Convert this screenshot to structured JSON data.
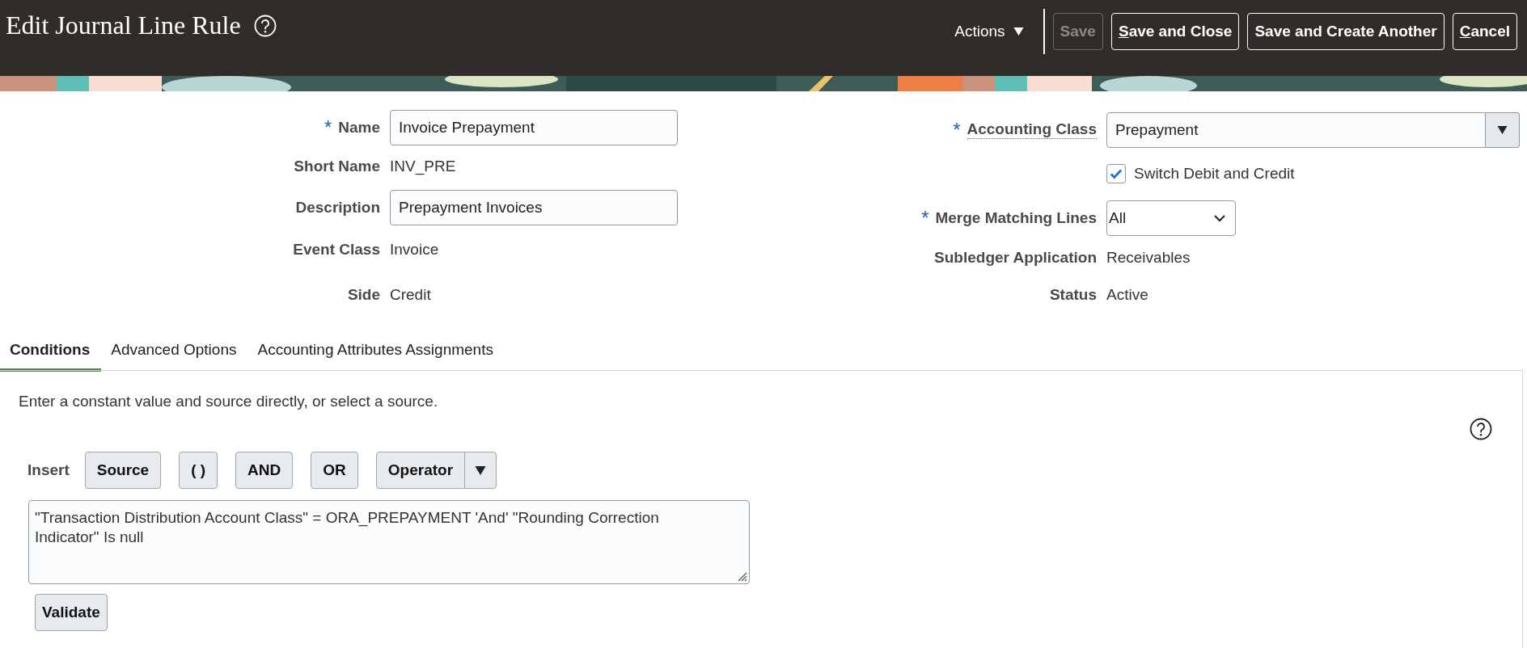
{
  "header": {
    "title": "Edit Journal Line Rule",
    "actions_menu": "Actions",
    "buttons": [
      {
        "label": "Save",
        "disabled": true,
        "mnemonic": false
      },
      {
        "label": "Save and Close",
        "disabled": false,
        "mnemonic": true
      },
      {
        "label": "Save and Create Another",
        "disabled": false,
        "mnemonic": false
      },
      {
        "label": "Cancel",
        "disabled": false,
        "mnemonic": true
      }
    ]
  },
  "form": {
    "left": [
      {
        "kind": "input",
        "required_mark": "*",
        "label": "Name",
        "value": "Invoice Prepayment"
      },
      {
        "kind": "text",
        "label": "Short Name",
        "value": "INV_PRE"
      },
      {
        "kind": "input",
        "label": "Description",
        "value": "Prepayment Invoices"
      },
      {
        "kind": "text",
        "label": "Event Class",
        "value": "Invoice"
      },
      {
        "kind": "text",
        "label": "Side",
        "value": "Credit"
      }
    ],
    "right": [
      {
        "kind": "combo",
        "required_mark": "*",
        "label": "Accounting Class",
        "value": "Prepayment"
      },
      {
        "kind": "checkbox",
        "label": "Switch Debit and Credit",
        "checked": true
      },
      {
        "kind": "select",
        "required_mark": "*",
        "label": "Merge Matching Lines",
        "value": "All"
      },
      {
        "kind": "text",
        "label": "Subledger Application",
        "value": "Receivables"
      },
      {
        "kind": "text",
        "label": "Status",
        "value": "Active"
      }
    ]
  },
  "tabs": [
    {
      "label": "Conditions",
      "selected": true
    },
    {
      "label": "Advanced Options",
      "selected": false
    },
    {
      "label": "Accounting Attributes Assignments",
      "selected": false
    }
  ],
  "conditions": {
    "instruction": "Enter a constant value and source directly, or select a source.",
    "insert_label": "Insert",
    "insert_buttons": [
      {
        "kind": "button",
        "label": "Source"
      },
      {
        "kind": "button",
        "label": "( )"
      },
      {
        "kind": "button",
        "label": "AND"
      },
      {
        "kind": "button",
        "label": "OR"
      },
      {
        "kind": "menu",
        "label": "Operator"
      }
    ],
    "expression": " \"Transaction Distribution Account Class\" = ORA_PREPAYMENT 'And' \"Rounding Correction Indicator\" Is null",
    "validate": "Validate"
  }
}
